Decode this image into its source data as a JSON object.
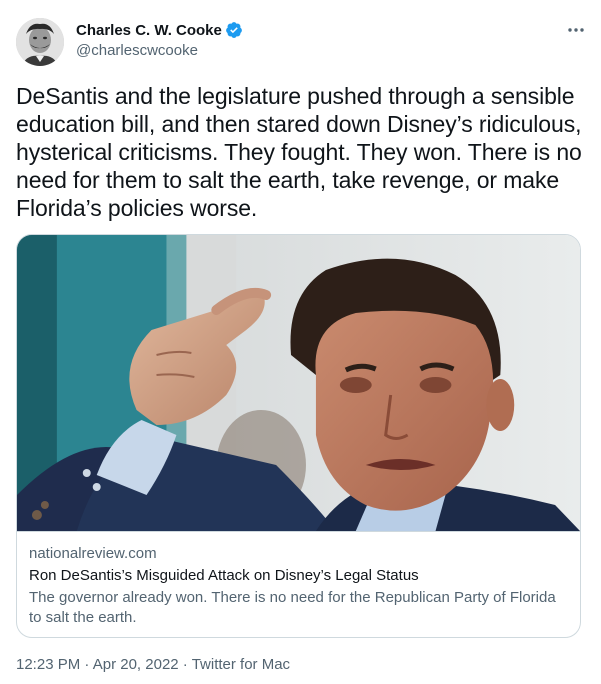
{
  "author": {
    "display_name": "Charles C. W. Cooke",
    "handle": "@charlescwcooke",
    "verified_icon": "verified-badge-icon",
    "avatar_icon": "avatar-portrait",
    "verified_color": "#1d9bf0"
  },
  "more_icon": "more-horizontal-icon",
  "tweet": {
    "text": "DeSantis and the legislature pushed through a sensible education bill, and then stared down Disney’s ridiculous, hysterical criticisms. They fought. They won. There is no need for them to salt the earth, take revenge, or make Florida’s policies worse."
  },
  "card": {
    "domain": "nationalreview.com",
    "title": "Ron DeSantis’s Misguided Attack on Disney’s Legal Status",
    "description": "The governor already won. There is no need for the Republican Party of Florida to salt the earth."
  },
  "meta": {
    "time": "12:23 PM",
    "separator": " · ",
    "date": "Apr 20, 2022",
    "source": "Twitter for Mac"
  }
}
